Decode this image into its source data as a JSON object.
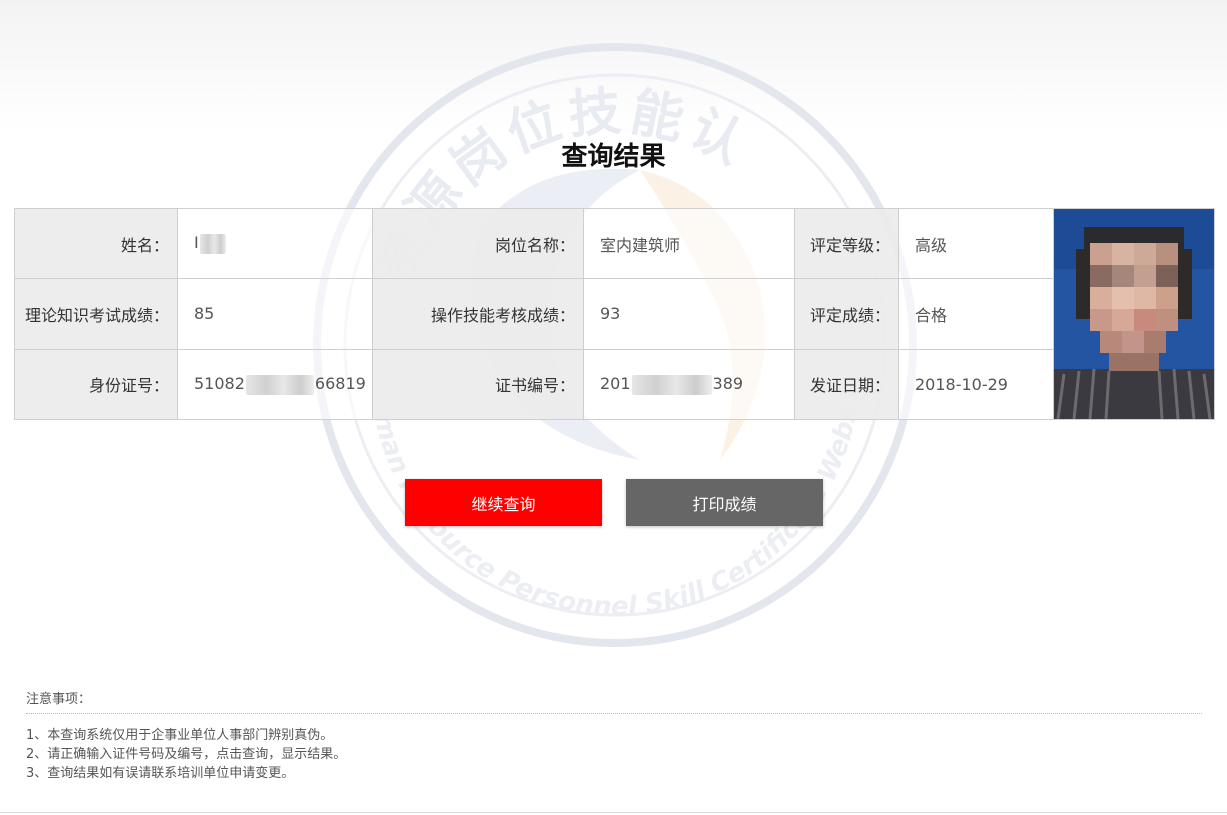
{
  "page": {
    "title": "查询结果"
  },
  "watermark": {
    "top_text": "资源岗位技能认",
    "bottom_text": "man Resource Personnel Skill Certificate Webs"
  },
  "result": {
    "rows": [
      {
        "label1": "姓名：",
        "value1_prefix": "I",
        "label2": "岗位名称：",
        "value2": "室内建筑师",
        "label3": "评定等级：",
        "value3": "高级"
      },
      {
        "label1": "理论知识考试成绩：",
        "value1": "85",
        "label2": "操作技能考核成绩：",
        "value2": "93",
        "label3": "评定成绩：",
        "value3": "合格"
      },
      {
        "label1": "身份证号：",
        "value1_prefix": "51082",
        "value1_suffix": "66819",
        "label2": "证书编号：",
        "value2_prefix": "201",
        "value2_suffix": "389",
        "label3": "发证日期：",
        "value3": "2018-10-29"
      }
    ]
  },
  "buttons": {
    "continue_label": "继续查询",
    "print_label": "打印成绩"
  },
  "notes": {
    "title": "注意事项：",
    "items": [
      "1、本查询系统仅用于企事业单位人事部门辨别真伪。",
      "2、请正确输入证件号码及编号，点击查询，显示结果。",
      "3、查询结果如有误请联系培训单位申请变更。"
    ]
  },
  "colors": {
    "continue_button": "#ff0000",
    "print_button": "#666666",
    "label_bg": "#ececec"
  },
  "icons": {
    "watermark": "certificate-seal-icon",
    "photo": "person-photo"
  }
}
